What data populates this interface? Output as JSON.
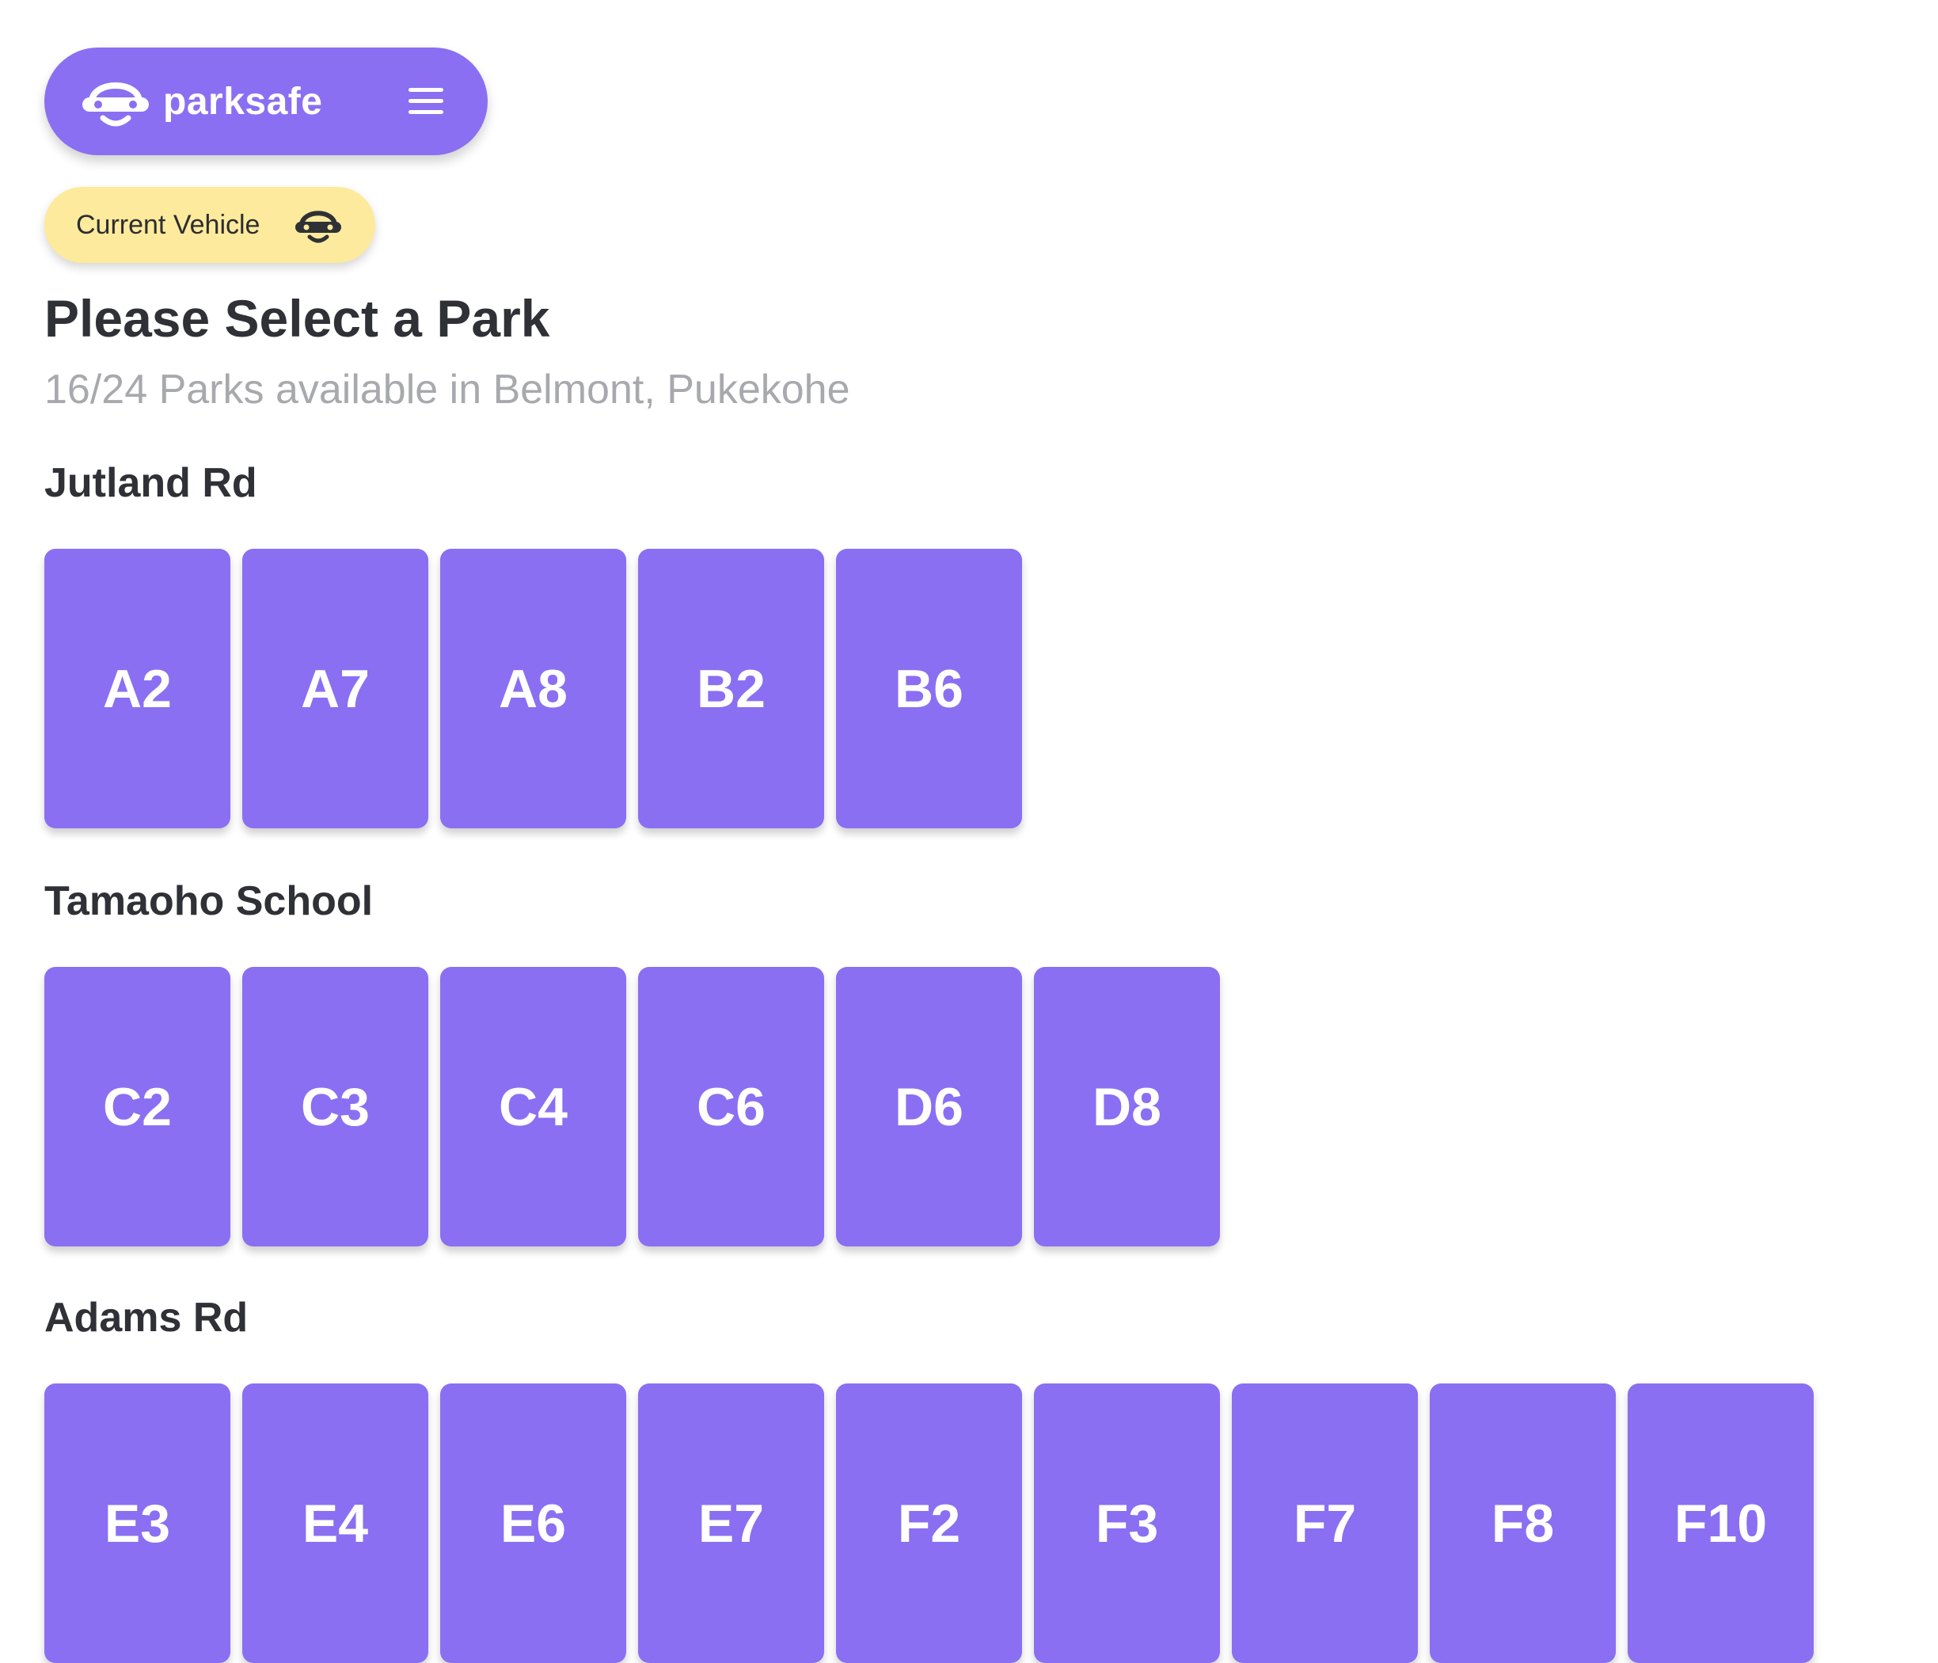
{
  "header": {
    "brand": "parksafe",
    "logo_icon": "car-face-icon",
    "menu_icon": "hamburger-menu-icon",
    "color": "#8a6ff2"
  },
  "vehicle": {
    "label": "Current Vehicle",
    "icon": "car-face-icon",
    "color": "#fdea9c"
  },
  "page": {
    "title": "Please Select a Park",
    "subtitle": "16/24 Parks available in Belmont, Pukekohe"
  },
  "sections": [
    {
      "title": "Jutland Rd",
      "parks": [
        "A2",
        "A7",
        "A8",
        "B2",
        "B6"
      ]
    },
    {
      "title": "Tamaoho School",
      "parks": [
        "C2",
        "C3",
        "C4",
        "C6",
        "D6",
        "D8"
      ]
    },
    {
      "title": "Adams Rd",
      "parks": [
        "E3",
        "E4",
        "E6",
        "E7",
        "F2",
        "F3",
        "F7",
        "F8",
        "F10"
      ]
    }
  ],
  "colors": {
    "accent": "#8a6ff2",
    "highlight": "#fdea9c",
    "text": "#2f3136",
    "muted": "#a8a9ad"
  }
}
